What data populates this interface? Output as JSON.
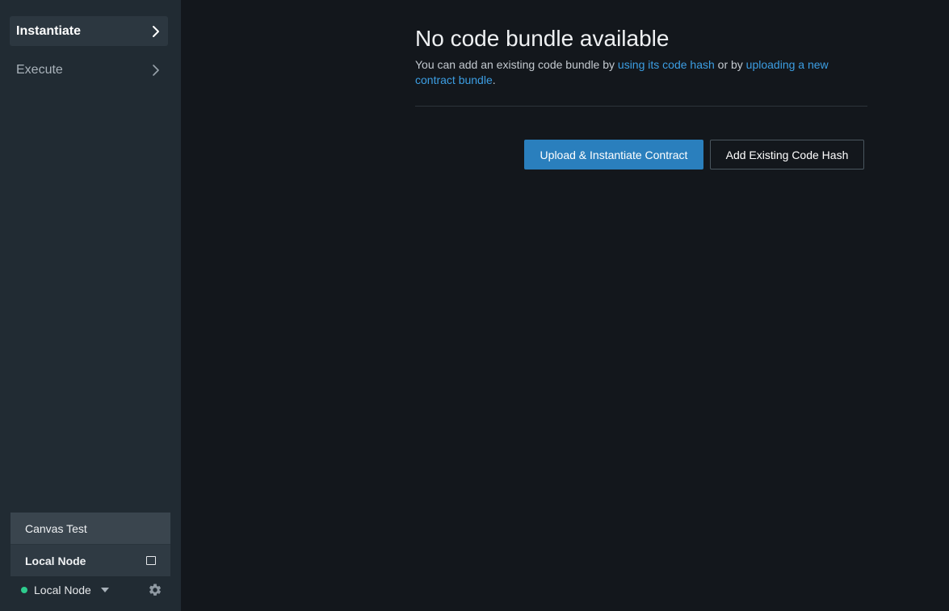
{
  "sidebar": {
    "items": [
      {
        "label": "Instantiate",
        "active": true,
        "icon": "chevron-right-icon"
      },
      {
        "label": "Execute",
        "active": false,
        "icon": "chevron-right-icon"
      }
    ],
    "account": {
      "name": "Canvas Test",
      "node_label": "Local Node",
      "node_icon": "square-icon"
    },
    "footer": {
      "status_color": "#2ecc8e",
      "node_select": "Local Node",
      "caret_icon": "caret-down-icon",
      "settings_icon": "gear-icon"
    }
  },
  "main": {
    "title": "No code bundle available",
    "description": {
      "prefix": "You can add an existing code bundle by ",
      "link1": "using its code hash",
      "middle": " or by ",
      "link2": "uploading a new contract bundle",
      "suffix": "."
    },
    "buttons": {
      "primary": "Upload & Instantiate Contract",
      "secondary": "Add Existing Code Hash"
    }
  },
  "colors": {
    "accent": "#2a7fbd",
    "link": "#3c9ee3",
    "sidebar_bg": "#212b33",
    "main_bg": "#13171c"
  }
}
